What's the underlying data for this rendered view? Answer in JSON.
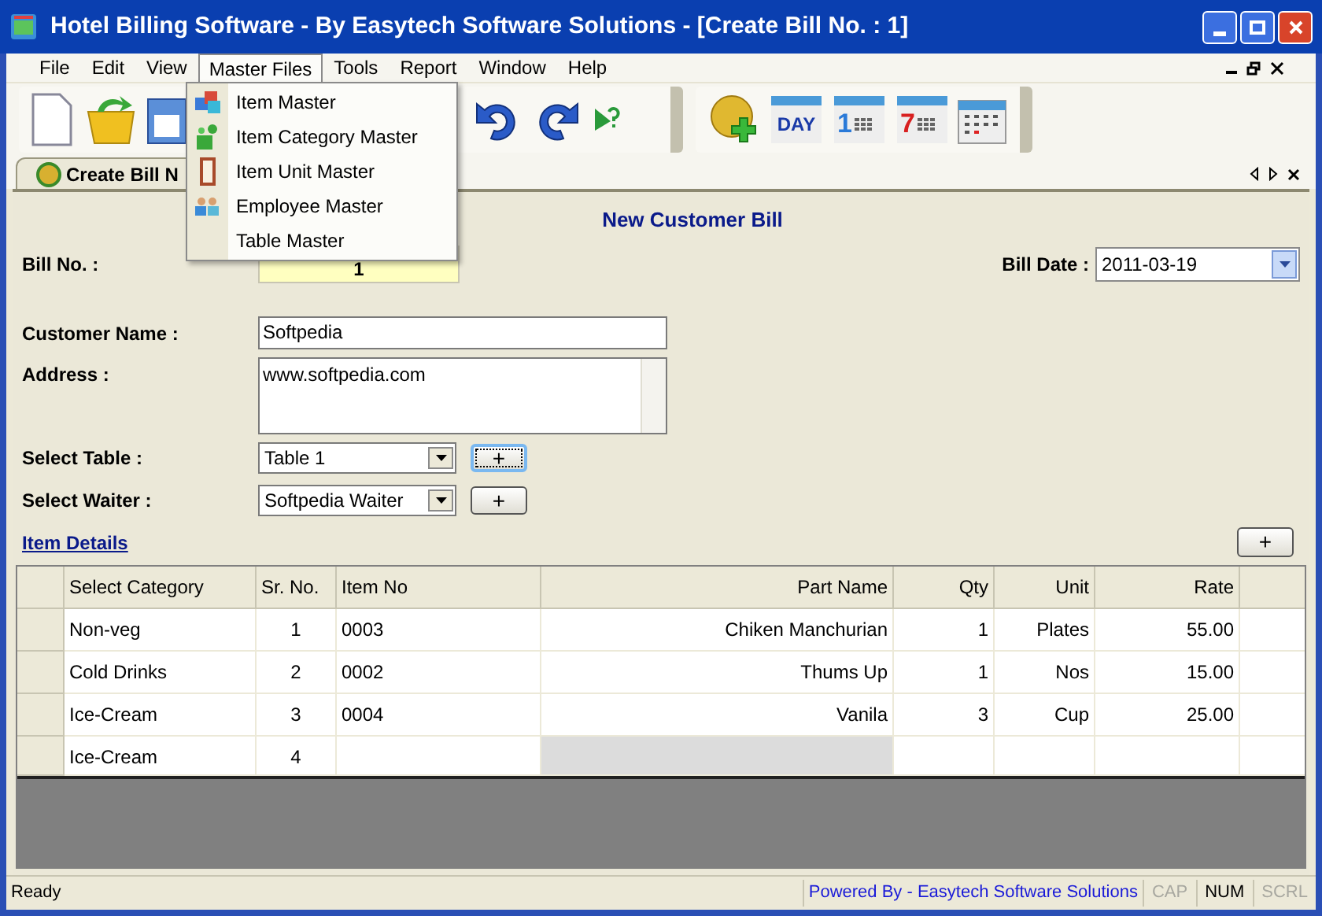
{
  "window": {
    "title": "Hotel Billing Software - By Easytech Software Solutions - [Create Bill No. : 1]"
  },
  "menu_bar": [
    {
      "label": "File",
      "selected": false
    },
    {
      "label": "Edit",
      "selected": false
    },
    {
      "label": "View",
      "selected": false
    },
    {
      "label": "Master Files",
      "selected": true
    },
    {
      "label": "Tools",
      "selected": false
    },
    {
      "label": "Report",
      "selected": false
    },
    {
      "label": "Window",
      "selected": false
    },
    {
      "label": "Help",
      "selected": false
    }
  ],
  "dropdown": [
    {
      "label": "Item Master"
    },
    {
      "label": "Item Category Master"
    },
    {
      "label": "Item Unit Master"
    },
    {
      "label": "Employee Master"
    },
    {
      "label": "Table Master"
    }
  ],
  "calendar_tools": [
    {
      "label": "DAY"
    },
    {
      "label": "1"
    },
    {
      "label": "7"
    }
  ],
  "tab": {
    "label": "Create Bill N",
    "selected": true
  },
  "form": {
    "heading": "New Customer Bill",
    "bill_no": {
      "label": "Bill No. :",
      "value": "1"
    },
    "bill_date": {
      "label": "Bill Date :",
      "value": "2011-03-19"
    },
    "customer_name": {
      "label": "Customer Name :",
      "value": "Softpedia"
    },
    "address": {
      "label": "Address :",
      "value": "www.softpedia.com"
    },
    "select_table": {
      "label": "Select Table :",
      "value": "Table 1",
      "button": "+",
      "focused": true
    },
    "select_waiter": {
      "label": "Select Waiter :",
      "value": "Softpedia Waiter",
      "button": "+",
      "focused": false
    },
    "item_details_link": "Item Details",
    "add_button": "+"
  },
  "table": {
    "columns": [
      "Select Category",
      "Sr. No.",
      "Item No",
      "Part Name",
      "Qty",
      "Unit",
      "Rate"
    ],
    "rows": [
      {
        "cells": [
          "Non-veg",
          "1",
          "0003",
          "Chiken Manchurian",
          "1",
          "Plates",
          "55.00"
        ],
        "editing": false
      },
      {
        "cells": [
          "Cold Drinks",
          "2",
          "0002",
          "Thums Up",
          "1",
          "Nos",
          "15.00"
        ],
        "editing": false
      },
      {
        "cells": [
          "Ice-Cream",
          "3",
          "0004",
          "Vanila",
          "3",
          "Cup",
          "25.00"
        ],
        "editing": false
      },
      {
        "cells": [
          "Ice-Cream",
          "4",
          "",
          "",
          "",
          "",
          ""
        ],
        "editing": true
      }
    ]
  },
  "status_bar": {
    "text": "Ready",
    "powered_by": "Powered By - Easytech Software Solutions",
    "indicators": [
      {
        "label": "CAP",
        "on": false
      },
      {
        "label": "NUM",
        "on": true
      },
      {
        "label": "SCRL",
        "on": false
      }
    ]
  }
}
